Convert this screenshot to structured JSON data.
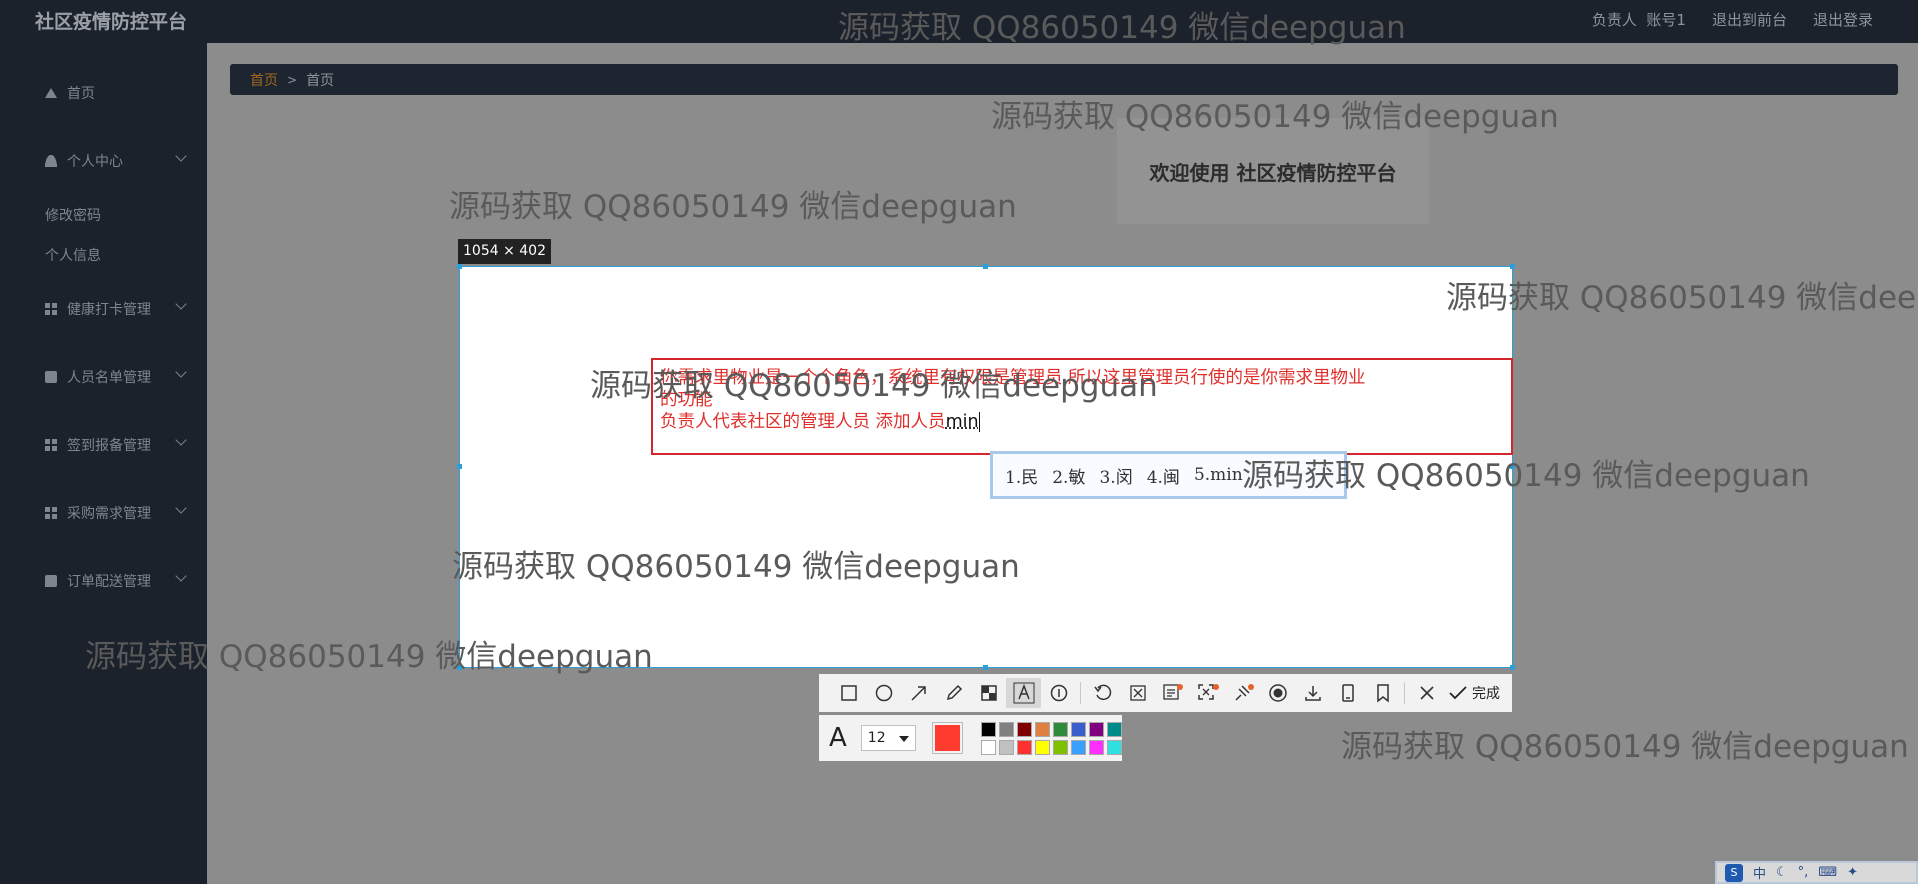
{
  "header": {
    "app_title": "社区疫情防控平台",
    "user_label": "负责人",
    "account": "账号1",
    "to_front": "退出到前台",
    "logout": "退出登录"
  },
  "sidebar": {
    "items": [
      {
        "label": "首页",
        "icon": "home-icon"
      },
      {
        "label": "个人中心",
        "icon": "user-icon"
      },
      {
        "label": "健康打卡管理",
        "icon": "grid-icon"
      },
      {
        "label": "人员名单管理",
        "icon": "clipboard-icon"
      },
      {
        "label": "签到报备管理",
        "icon": "grid-icon"
      },
      {
        "label": "采购需求管理",
        "icon": "grid-icon"
      },
      {
        "label": "订单配送管理",
        "icon": "chat-icon"
      }
    ],
    "subitems": [
      "修改密码",
      "个人信息"
    ]
  },
  "breadcrumb": {
    "home": "首页",
    "current": "首页"
  },
  "welcome": "欢迎使用  社区疫情防控平台",
  "screenshot_tool": {
    "size_label": "1054 × 402",
    "typed_line1": "你需求里物业是一个个角色，系统里有权限是管理员 所以这里管理员行使的是你需求里物业",
    "typed_line2": "的功能",
    "typed_line3": "负责人代表社区的管理人员 添加人员",
    "composing": "min",
    "ime_candidates": [
      "1.民",
      "2.敏",
      "3.闵",
      "4.闽",
      "5.min"
    ],
    "toolbar": {
      "tools": [
        "rectangle-icon",
        "ellipse-icon",
        "arrow-icon",
        "pencil-icon",
        "mosaic-icon",
        "text-icon",
        "number-icon",
        "undo-icon",
        "cut-icon",
        "ocr-icon",
        "scroll-capture-icon",
        "pin-icon",
        "record-icon",
        "download-icon",
        "save-icon",
        "bookmark-icon",
        "close-icon"
      ],
      "done": "完成"
    },
    "font_size": "12",
    "current_color": "#ff3b30",
    "palette": [
      "#000000",
      "#808080",
      "#800000",
      "#e08040",
      "#2e8b3a",
      "#3a5fcd",
      "#800080",
      "#008b8b",
      "#ffffff",
      "#c0c0c0",
      "#ff3030",
      "#ffff00",
      "#7fc000",
      "#3aa0ff",
      "#ff30ff",
      "#30e0e0"
    ]
  },
  "watermark": "源码获取 QQ86050149 微信deepguan",
  "tray": {
    "lang": "中"
  }
}
